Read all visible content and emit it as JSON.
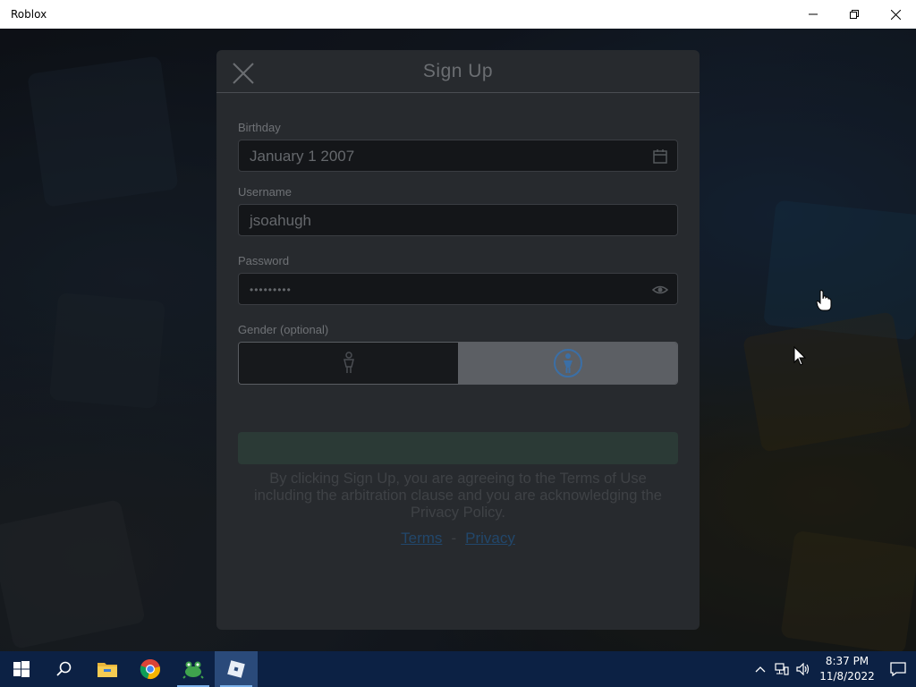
{
  "window": {
    "title": "Roblox"
  },
  "modal": {
    "title": "Sign Up",
    "birthday": {
      "label": "Birthday",
      "value": "January 1 2007"
    },
    "username": {
      "label": "Username",
      "value": "jsoahugh"
    },
    "password": {
      "label": "Password",
      "value": "•••••••••"
    },
    "gender": {
      "label": "Gender (optional)",
      "selected": "female"
    },
    "legal_text": "By clicking Sign Up, you are agreeing to the Terms of Use including the arbitration clause and you are acknowledging the Privacy Policy.",
    "links": {
      "terms": "Terms",
      "separator": "-",
      "privacy": "Privacy"
    }
  },
  "taskbar": {
    "apps": [
      "start",
      "search",
      "file-explorer",
      "chrome",
      "frog-app",
      "roblox"
    ],
    "clock": {
      "time": "8:37 PM",
      "date": "11/8/2022"
    }
  },
  "colors": {
    "taskbar": "#0c2144",
    "modal": "#272a2e",
    "link": "#22476b"
  }
}
